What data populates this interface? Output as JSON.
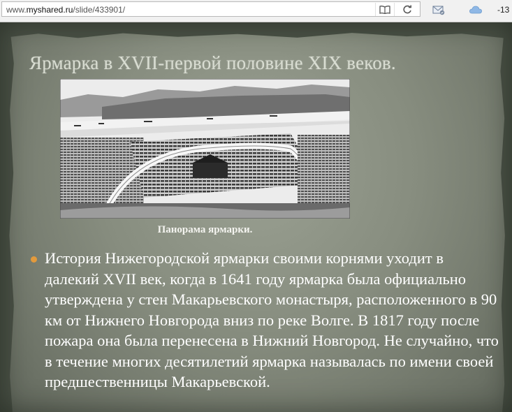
{
  "browser": {
    "url_prefix": "www.",
    "url_domain": "myshared.ru",
    "url_path": "/slide/433901/",
    "right_counter": "-13",
    "icons": [
      "reader-view-icon",
      "reload-icon",
      "mail-icon",
      "cloud-icon"
    ]
  },
  "slide": {
    "title": "Ярмарка в XVII-первой половине XIX веков.",
    "image_caption": "Панорама ярмарки.",
    "bullet_text": "История Нижегородской ярмарки своими корнями уходит в далекий XVII век, когда в 1641 году ярмарка была официально утверждена у стен Макарьевского монастыря, расположенного в 90 км от Нижнего Новгорода вниз по реке Волге. В 1817 году после пожара она была перенесена в Нижний Новгород. Не случайно, что в течение многих десятилетий ярмарка называлась по имени своей предшественницы Макарьевской.",
    "colors": {
      "background": "#4a5146",
      "paper": "#878d7f",
      "title": "#d9ddd2",
      "text": "#ffffff",
      "bullet": "#e39a3c"
    }
  }
}
